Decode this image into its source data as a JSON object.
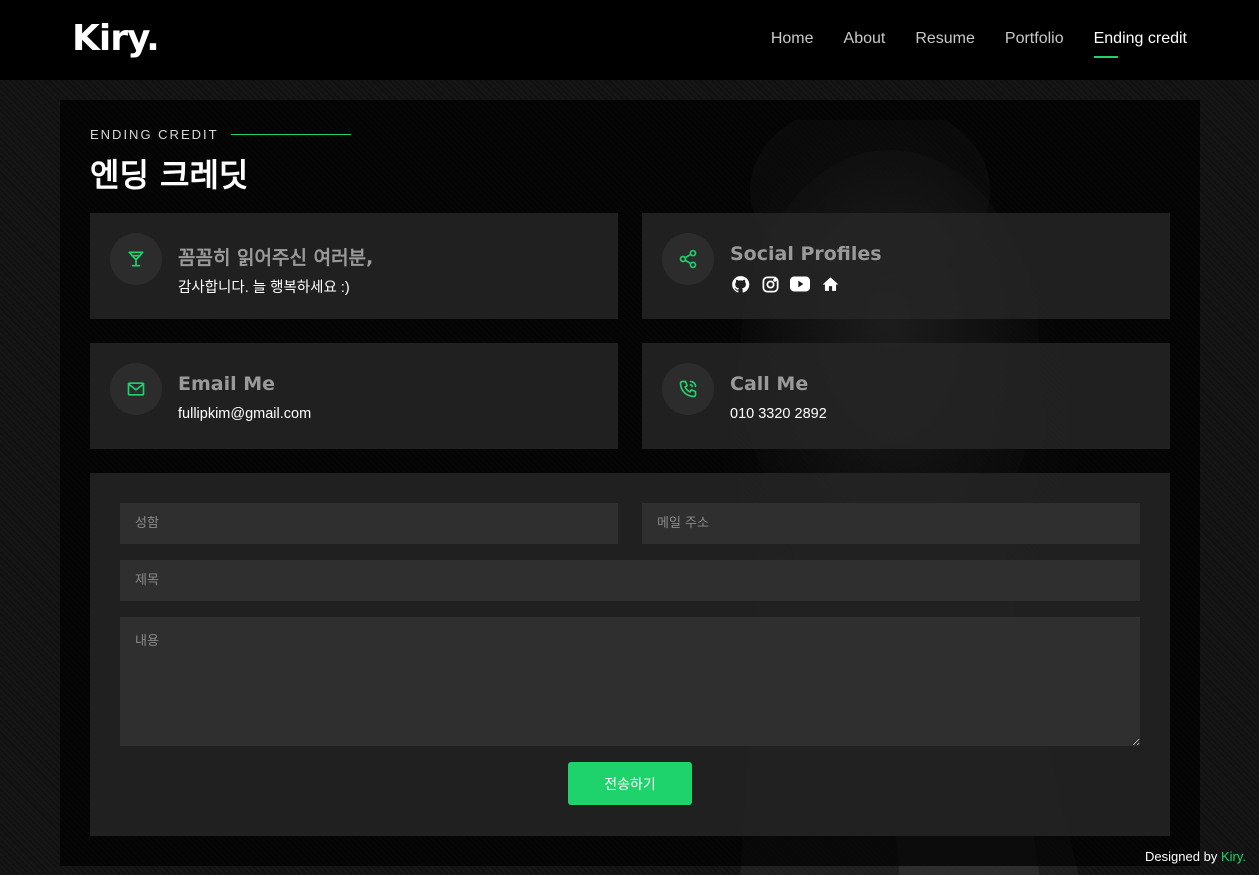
{
  "header": {
    "logo": "Kiry.",
    "nav": [
      "Home",
      "About",
      "Resume",
      "Portfolio",
      "Ending credit"
    ],
    "active_index": 4
  },
  "section": {
    "subtitle": "ENDING CREDIT",
    "title": "엔딩 크레딧"
  },
  "cards": {
    "thanks": {
      "title": "꼼꼼히 읽어주신 여러분,",
      "text": "감사합니다. 늘 행복하세요 :)",
      "icon": "cocktail-icon"
    },
    "social": {
      "title": "Social Profiles",
      "icons": [
        "github-icon",
        "instagram-icon",
        "youtube-icon",
        "home-icon"
      ],
      "icon": "share-icon"
    },
    "email": {
      "title": "Email Me",
      "text": "fullipkim@gmail.com",
      "icon": "mail-icon"
    },
    "call": {
      "title": "Call Me",
      "text": "010 3320 2892",
      "icon": "phone-icon"
    }
  },
  "form": {
    "name_placeholder": "성함",
    "email_placeholder": "메일 주소",
    "subject_placeholder": "제목",
    "message_placeholder": "내용",
    "submit_label": "전송하기"
  },
  "footer": {
    "designed_by": "Designed by",
    "brand": "Kiry."
  },
  "colors": {
    "accent": "#1ed26c",
    "card_bg": "#262626",
    "field_bg": "#2f2f2f"
  }
}
